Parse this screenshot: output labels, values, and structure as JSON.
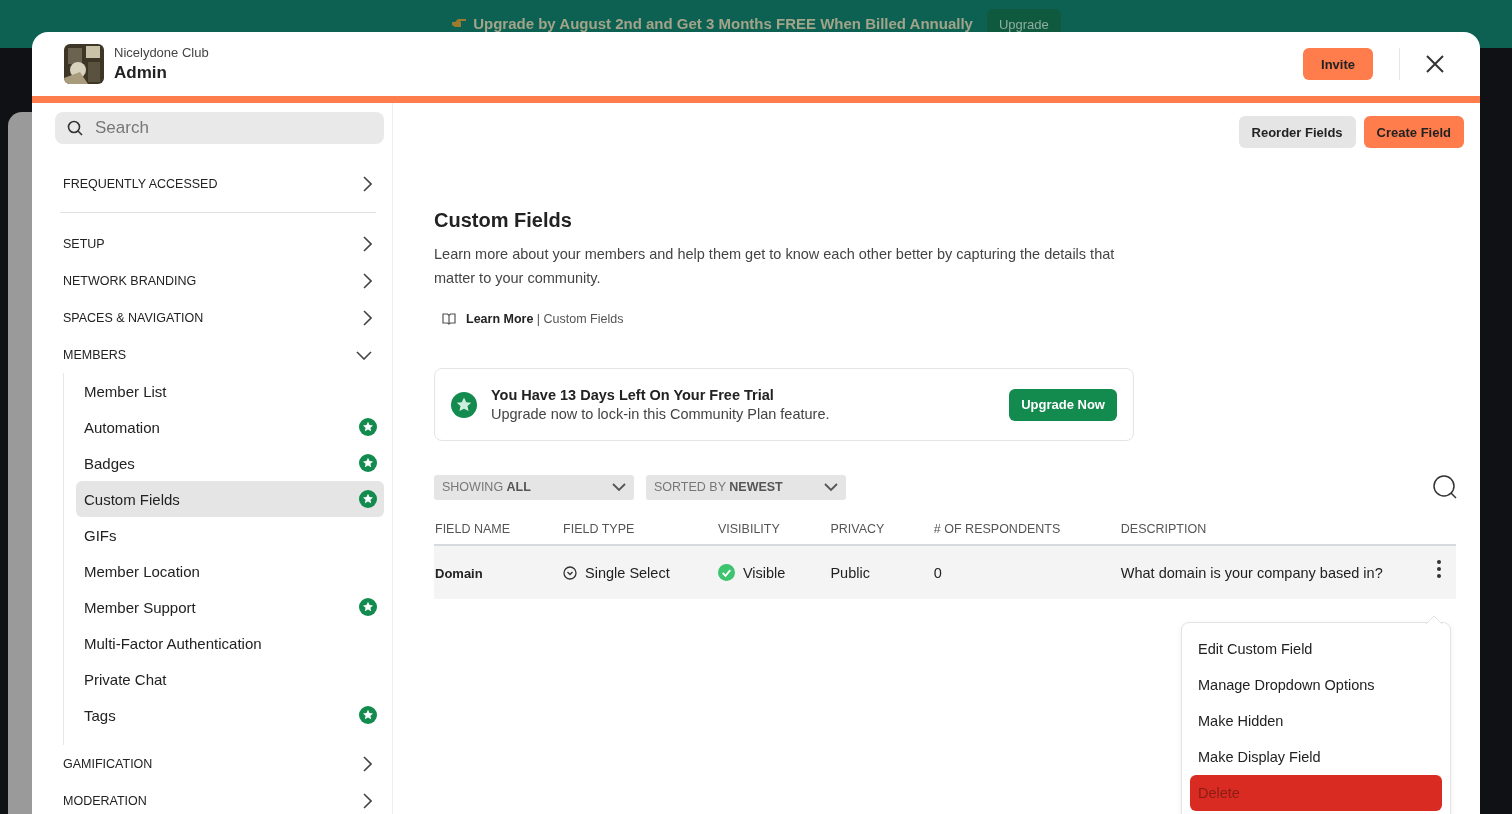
{
  "banner": {
    "text": "Upgrade by August 2nd and Get 3 Months FREE When Billed Annually",
    "button": "Upgrade"
  },
  "header": {
    "community": "Nicelydone Club",
    "title": "Admin",
    "invite": "Invite"
  },
  "sidebar": {
    "search": {
      "placeholder": "Search"
    },
    "sections": [
      {
        "label": "FREQUENTLY ACCESSED",
        "expanded": false
      },
      {
        "label": "SETUP",
        "expanded": false
      },
      {
        "label": "NETWORK BRANDING",
        "expanded": false
      },
      {
        "label": "SPACES & NAVIGATION",
        "expanded": false
      },
      {
        "label": "MEMBERS",
        "expanded": true,
        "children": [
          {
            "label": "Member List",
            "premium": false,
            "selected": false
          },
          {
            "label": "Automation",
            "premium": true,
            "selected": false
          },
          {
            "label": "Badges",
            "premium": true,
            "selected": false
          },
          {
            "label": "Custom Fields",
            "premium": true,
            "selected": true
          },
          {
            "label": "GIFs",
            "premium": false,
            "selected": false
          },
          {
            "label": "Member Location",
            "premium": false,
            "selected": false
          },
          {
            "label": "Member Support",
            "premium": true,
            "selected": false
          },
          {
            "label": "Multi-Factor Authentication",
            "premium": false,
            "selected": false
          },
          {
            "label": "Private Chat",
            "premium": false,
            "selected": false
          },
          {
            "label": "Tags",
            "premium": true,
            "selected": false
          }
        ]
      },
      {
        "label": "GAMIFICATION",
        "expanded": false
      },
      {
        "label": "MODERATION",
        "expanded": false
      }
    ]
  },
  "toolbar": {
    "buttons": [
      {
        "label": "Reorder Fields",
        "kind": "secondary"
      },
      {
        "label": "Create Field",
        "kind": "primary"
      }
    ]
  },
  "page": {
    "title": "Custom Fields",
    "description": "Learn more about your members and help them get to know each other better by capturing the details that matter to your community.",
    "link": "**Learn More** | Custom Fields"
  },
  "trial": {
    "title": "You Have 13 Days Left On Your Free Trial",
    "subtitle": "Upgrade now to lock-in this Community Plan feature.",
    "button": "Upgrade Now"
  },
  "filters": [
    "SHOWING **ALL**",
    "SORTED BY **NEWEST**"
  ],
  "table": {
    "columns": [
      "FIELD NAME",
      "FIELD TYPE",
      "VISIBILITY",
      "PRIVACY",
      "# OF RESPONDENTS",
      "DESCRIPTION"
    ],
    "rows": [
      {
        "field_name": "Domain",
        "field_type": "Single Select",
        "visibility": "Visible",
        "visible": true,
        "privacy": "Public",
        "respondents": "0",
        "description": "What domain is your company based in?"
      }
    ]
  },
  "menu": [
    {
      "label": "Edit Custom Field",
      "kind": "normal"
    },
    {
      "label": "Manage Dropdown Options",
      "kind": "normal"
    },
    {
      "label": "Make Hidden",
      "kind": "normal"
    },
    {
      "label": "Make Display Field",
      "kind": "normal"
    },
    {
      "label": "Delete",
      "kind": "danger"
    }
  ]
}
